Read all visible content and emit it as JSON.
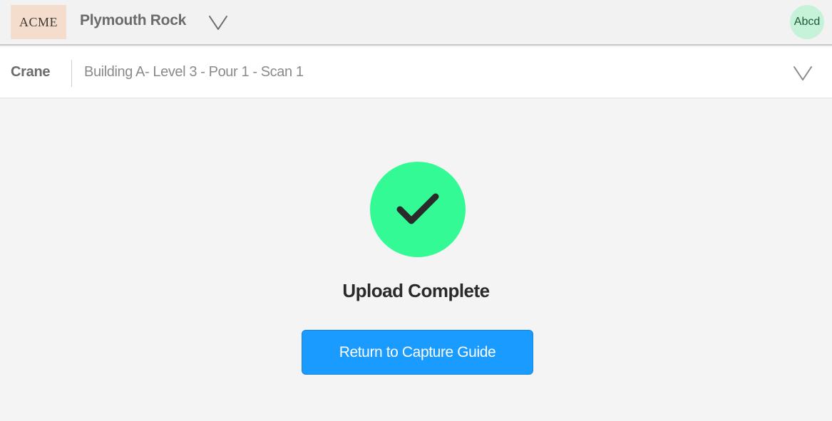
{
  "header": {
    "logo_text": "ACME",
    "project_name": "Plymouth Rock",
    "project_dropdown_icon": "chevron-down-icon",
    "avatar_text": "Abcd"
  },
  "selector": {
    "label": "Crane",
    "value": "Building A- Level 3 - Pour 1 - Scan 1",
    "dropdown_icon": "chevron-down-icon"
  },
  "status": {
    "icon": "checkmark-icon",
    "title": "Upload Complete",
    "button_label": "Return to Capture Guide"
  },
  "colors": {
    "success": "#34fa96",
    "primary_button": "#1a9bff",
    "logo_bg": "#f5ddcd",
    "avatar_bg": "#c5f2d8"
  }
}
